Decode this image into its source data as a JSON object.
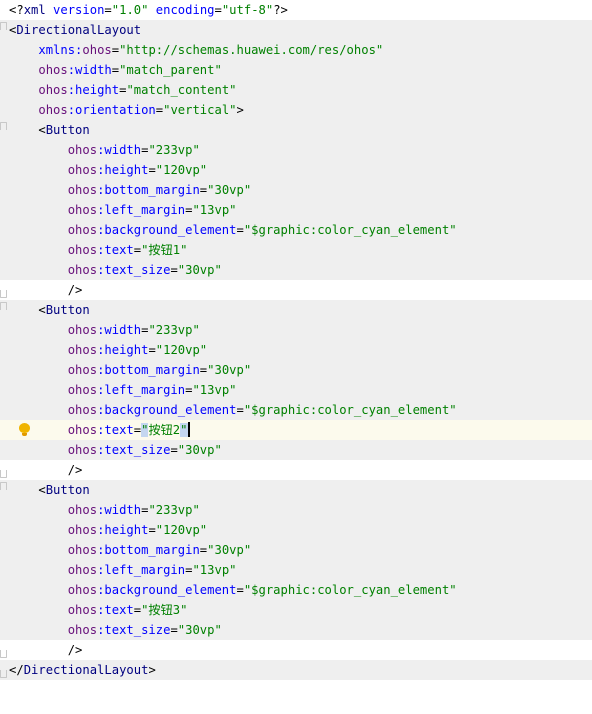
{
  "editor": {
    "language": "xml",
    "current_line": 21,
    "selected_text": "\"",
    "intention_icon": "lightbulb-icon",
    "colors": {
      "tag": "#000080",
      "attr_namespace": "#660e7a",
      "attr_name": "#0000ff",
      "attr_value": "#008000",
      "current_line_bg": "#fcfaed",
      "shaded_bg": "#efefef"
    },
    "lines": [
      {
        "indent": "",
        "parts": [
          [
            "p",
            "<?"
          ],
          [
            "t",
            "xml "
          ],
          [
            "a",
            "version"
          ],
          [
            "p",
            "="
          ],
          [
            "v",
            "\"1.0\" "
          ],
          [
            "a",
            "encoding"
          ],
          [
            "p",
            "="
          ],
          [
            "v",
            "\"utf-8\""
          ],
          [
            "p",
            "?>"
          ]
        ]
      },
      {
        "indent": "",
        "parts": [
          [
            "p",
            "<"
          ],
          [
            "t",
            "DirectionalLayout"
          ]
        ]
      },
      {
        "indent": "    ",
        "parts": [
          [
            "a",
            "xmlns:"
          ],
          [
            "n",
            "ohos"
          ],
          [
            "p",
            "="
          ],
          [
            "v",
            "\"http://schemas.huawei.com/res/ohos\""
          ]
        ]
      },
      {
        "indent": "    ",
        "parts": [
          [
            "n",
            "ohos"
          ],
          [
            "a",
            ":width"
          ],
          [
            "p",
            "="
          ],
          [
            "v",
            "\"match_parent\""
          ]
        ]
      },
      {
        "indent": "    ",
        "parts": [
          [
            "n",
            "ohos"
          ],
          [
            "a",
            ":height"
          ],
          [
            "p",
            "="
          ],
          [
            "v",
            "\"match_content\""
          ]
        ]
      },
      {
        "indent": "    ",
        "parts": [
          [
            "n",
            "ohos"
          ],
          [
            "a",
            ":orientation"
          ],
          [
            "p",
            "="
          ],
          [
            "v",
            "\"vertical\""
          ],
          [
            "p",
            ">"
          ]
        ]
      },
      {
        "indent": "    ",
        "parts": [
          [
            "p",
            "<"
          ],
          [
            "t",
            "Button"
          ]
        ]
      },
      {
        "indent": "        ",
        "parts": [
          [
            "n",
            "ohos"
          ],
          [
            "a",
            ":width"
          ],
          [
            "p",
            "="
          ],
          [
            "v",
            "\"233vp\""
          ]
        ]
      },
      {
        "indent": "        ",
        "parts": [
          [
            "n",
            "ohos"
          ],
          [
            "a",
            ":height"
          ],
          [
            "p",
            "="
          ],
          [
            "v",
            "\"120vp\""
          ]
        ]
      },
      {
        "indent": "        ",
        "parts": [
          [
            "n",
            "ohos"
          ],
          [
            "a",
            ":bottom_margin"
          ],
          [
            "p",
            "="
          ],
          [
            "v",
            "\"30vp\""
          ]
        ]
      },
      {
        "indent": "        ",
        "parts": [
          [
            "n",
            "ohos"
          ],
          [
            "a",
            ":left_margin"
          ],
          [
            "p",
            "="
          ],
          [
            "v",
            "\"13vp\""
          ]
        ]
      },
      {
        "indent": "        ",
        "parts": [
          [
            "n",
            "ohos"
          ],
          [
            "a",
            ":background_element"
          ],
          [
            "p",
            "="
          ],
          [
            "v",
            "\"$graphic:color_cyan_element\""
          ]
        ]
      },
      {
        "indent": "        ",
        "parts": [
          [
            "n",
            "ohos"
          ],
          [
            "a",
            ":text"
          ],
          [
            "p",
            "="
          ],
          [
            "v",
            "\"按钮1\""
          ]
        ]
      },
      {
        "indent": "        ",
        "parts": [
          [
            "n",
            "ohos"
          ],
          [
            "a",
            ":text_size"
          ],
          [
            "p",
            "="
          ],
          [
            "v",
            "\"30vp\""
          ]
        ]
      },
      {
        "indent": "        ",
        "parts": [
          [
            "p",
            "/>"
          ]
        ]
      },
      {
        "indent": "    ",
        "parts": [
          [
            "p",
            "<"
          ],
          [
            "t",
            "Button"
          ]
        ]
      },
      {
        "indent": "        ",
        "parts": [
          [
            "n",
            "ohos"
          ],
          [
            "a",
            ":width"
          ],
          [
            "p",
            "="
          ],
          [
            "v",
            "\"233vp\""
          ]
        ]
      },
      {
        "indent": "        ",
        "parts": [
          [
            "n",
            "ohos"
          ],
          [
            "a",
            ":height"
          ],
          [
            "p",
            "="
          ],
          [
            "v",
            "\"120vp\""
          ]
        ]
      },
      {
        "indent": "        ",
        "parts": [
          [
            "n",
            "ohos"
          ],
          [
            "a",
            ":bottom_margin"
          ],
          [
            "p",
            "="
          ],
          [
            "v",
            "\"30vp\""
          ]
        ]
      },
      {
        "indent": "        ",
        "parts": [
          [
            "n",
            "ohos"
          ],
          [
            "a",
            ":left_margin"
          ],
          [
            "p",
            "="
          ],
          [
            "v",
            "\"13vp\""
          ]
        ]
      },
      {
        "indent": "        ",
        "parts": [
          [
            "n",
            "ohos"
          ],
          [
            "a",
            ":background_element"
          ],
          [
            "p",
            "="
          ],
          [
            "v",
            "\"$graphic:color_cyan_element\""
          ]
        ]
      },
      {
        "indent": "        ",
        "parts": [
          [
            "n",
            "ohos"
          ],
          [
            "a",
            ":text"
          ],
          [
            "p",
            "="
          ],
          [
            "sel",
            "\""
          ],
          [
            "v",
            "按钮2"
          ],
          [
            "sel",
            "\""
          ],
          [
            "caret",
            ""
          ]
        ]
      },
      {
        "indent": "        ",
        "parts": [
          [
            "n",
            "ohos"
          ],
          [
            "a",
            ":text_size"
          ],
          [
            "p",
            "="
          ],
          [
            "v",
            "\"30vp\""
          ]
        ]
      },
      {
        "indent": "        ",
        "parts": [
          [
            "p",
            "/>"
          ]
        ]
      },
      {
        "indent": "    ",
        "parts": [
          [
            "p",
            "<"
          ],
          [
            "t",
            "Button"
          ]
        ]
      },
      {
        "indent": "        ",
        "parts": [
          [
            "n",
            "ohos"
          ],
          [
            "a",
            ":width"
          ],
          [
            "p",
            "="
          ],
          [
            "v",
            "\"233vp\""
          ]
        ]
      },
      {
        "indent": "        ",
        "parts": [
          [
            "n",
            "ohos"
          ],
          [
            "a",
            ":height"
          ],
          [
            "p",
            "="
          ],
          [
            "v",
            "\"120vp\""
          ]
        ]
      },
      {
        "indent": "        ",
        "parts": [
          [
            "n",
            "ohos"
          ],
          [
            "a",
            ":bottom_margin"
          ],
          [
            "p",
            "="
          ],
          [
            "v",
            "\"30vp\""
          ]
        ]
      },
      {
        "indent": "        ",
        "parts": [
          [
            "n",
            "ohos"
          ],
          [
            "a",
            ":left_margin"
          ],
          [
            "p",
            "="
          ],
          [
            "v",
            "\"13vp\""
          ]
        ]
      },
      {
        "indent": "        ",
        "parts": [
          [
            "n",
            "ohos"
          ],
          [
            "a",
            ":background_element"
          ],
          [
            "p",
            "="
          ],
          [
            "v",
            "\"$graphic:color_cyan_element\""
          ]
        ]
      },
      {
        "indent": "        ",
        "parts": [
          [
            "n",
            "ohos"
          ],
          [
            "a",
            ":text"
          ],
          [
            "p",
            "="
          ],
          [
            "v",
            "\"按钮3\""
          ]
        ]
      },
      {
        "indent": "        ",
        "parts": [
          [
            "n",
            "ohos"
          ],
          [
            "a",
            ":text_size"
          ],
          [
            "p",
            "="
          ],
          [
            "v",
            "\"30vp\""
          ]
        ]
      },
      {
        "indent": "        ",
        "parts": [
          [
            "p",
            "/>"
          ]
        ]
      },
      {
        "indent": "",
        "parts": [
          [
            "p",
            "</"
          ],
          [
            "t",
            "DirectionalLayout"
          ],
          [
            "p",
            ">"
          ]
        ]
      }
    ]
  }
}
